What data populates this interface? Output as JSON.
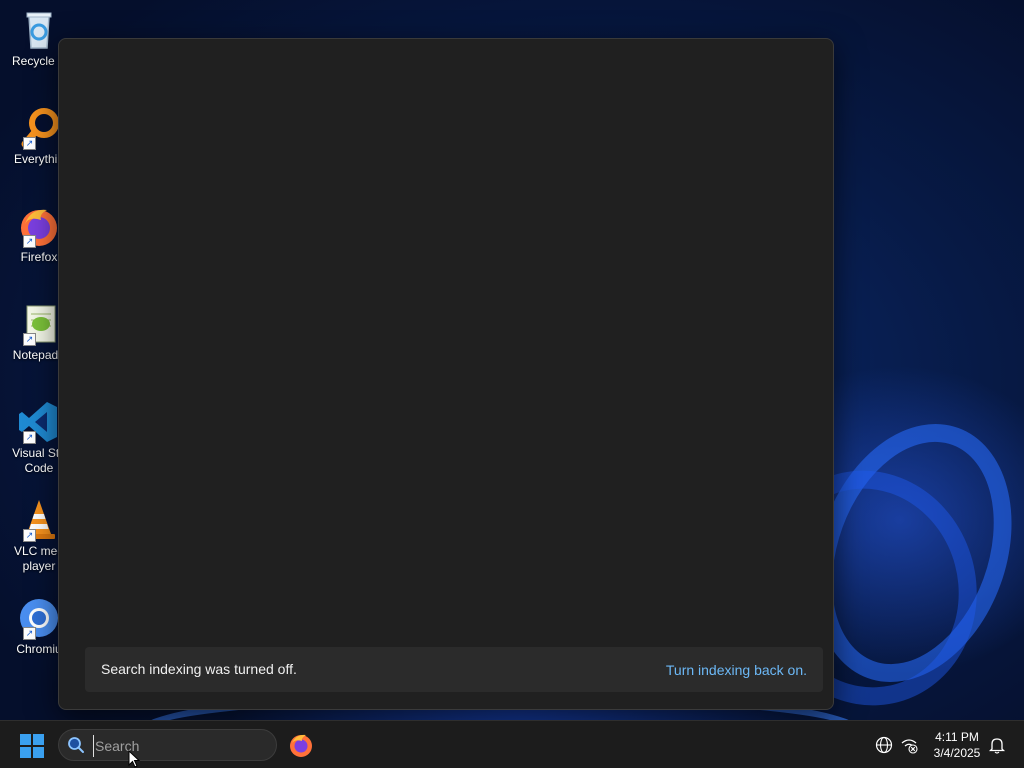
{
  "desktop": {
    "icons": [
      {
        "label": "Recycle B",
        "icon": "recycle-bin-icon"
      },
      {
        "label": "Everythin",
        "icon": "everything-search-icon"
      },
      {
        "label": "Firefox",
        "icon": "firefox-icon"
      },
      {
        "label": "Notepad+",
        "icon": "notepad-plus-plus-icon"
      },
      {
        "label": "Visual Stu\nCode",
        "icon": "vscode-icon"
      },
      {
        "label": "VLC med\nplayer",
        "icon": "vlc-icon"
      },
      {
        "label": "Chromiu",
        "icon": "chromium-icon"
      }
    ]
  },
  "search_panel": {
    "indexing_message": "Search indexing was turned off.",
    "indexing_link": "Turn indexing back on."
  },
  "taskbar": {
    "start_icon": "windows-start-icon",
    "search": {
      "placeholder": "Search",
      "value": ""
    },
    "pinned": [
      {
        "icon": "firefox-icon"
      }
    ],
    "tray": {
      "icons": [
        "globe-language-icon",
        "network-disconnected-icon",
        "notification-bell-icon"
      ],
      "time": "4:11 PM",
      "date": "3/4/2025"
    }
  },
  "colors": {
    "panel_bg": "#202020",
    "banner_bg": "#2b2b2b",
    "link": "#6cb8f6",
    "taskbar_bg": "#1c1c1c",
    "accent": "#3aa0f0"
  }
}
